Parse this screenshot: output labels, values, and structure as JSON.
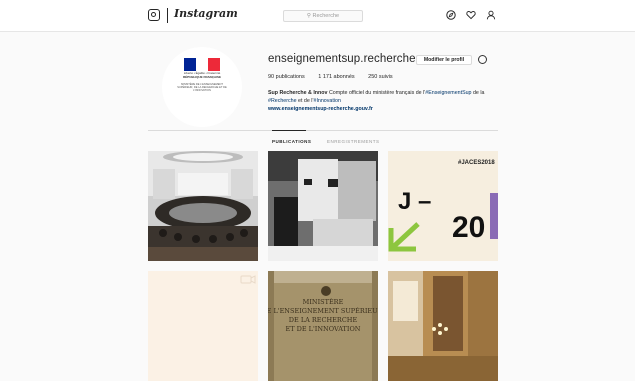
{
  "nav": {
    "brand": "Instagram",
    "search_placeholder": "Recherche"
  },
  "profile": {
    "username": "enseignementsup.recherche",
    "edit_button": "Modifier le profil",
    "stats": {
      "publications": "90 publications",
      "followers": "1 171 abonnés",
      "following": "250 suivis"
    },
    "bio_name": "Sup Recherche & Innov",
    "bio_text_1": "Compte officiel du ministère français de l'",
    "bio_tag_1": "#EnseignementSup",
    "bio_text_2": "de la",
    "bio_tag_2": "#Recherche",
    "bio_text_3": "et de l'",
    "bio_tag_3": "#Innovation",
    "website": "www.enseignementsup-recherche.gouv.fr",
    "logo": {
      "motto": "Liberté • Égalité • Fraternité",
      "republic": "RÉPUBLIQUE FRANÇAISE",
      "ministry": "MINISTÈRE DE L'ENSEIGNEMENT SUPÉRIEUR, DE LA RECHERCHE ET DE L'INNOVATION"
    }
  },
  "tabs": {
    "posts": "PUBLICATIONS",
    "saved": "ENREGISTREMENTS"
  },
  "posts": [
    {
      "alt": "conference room"
    },
    {
      "alt": "exhibition stand"
    },
    {
      "hashtag": "#JACES2018",
      "big_text": "J –",
      "number": "20"
    },
    {
      "alt": "video post"
    },
    {
      "sign_lines": [
        "MINISTÈRE",
        "DE L'ENSEIGNEMENT SUPÉRIEUR,",
        "DE LA RECHERCHE",
        "ET DE L'INNOVATION"
      ]
    },
    {
      "alt": "interior with chandelier"
    }
  ],
  "colors": {
    "flag_blue": "#002395",
    "flag_red": "#ED2939",
    "link_blue": "#003569",
    "jaces_bg": "#f6eedf",
    "jaces_green": "#8dc63f",
    "jaces_purple": "#8a6bb5"
  }
}
